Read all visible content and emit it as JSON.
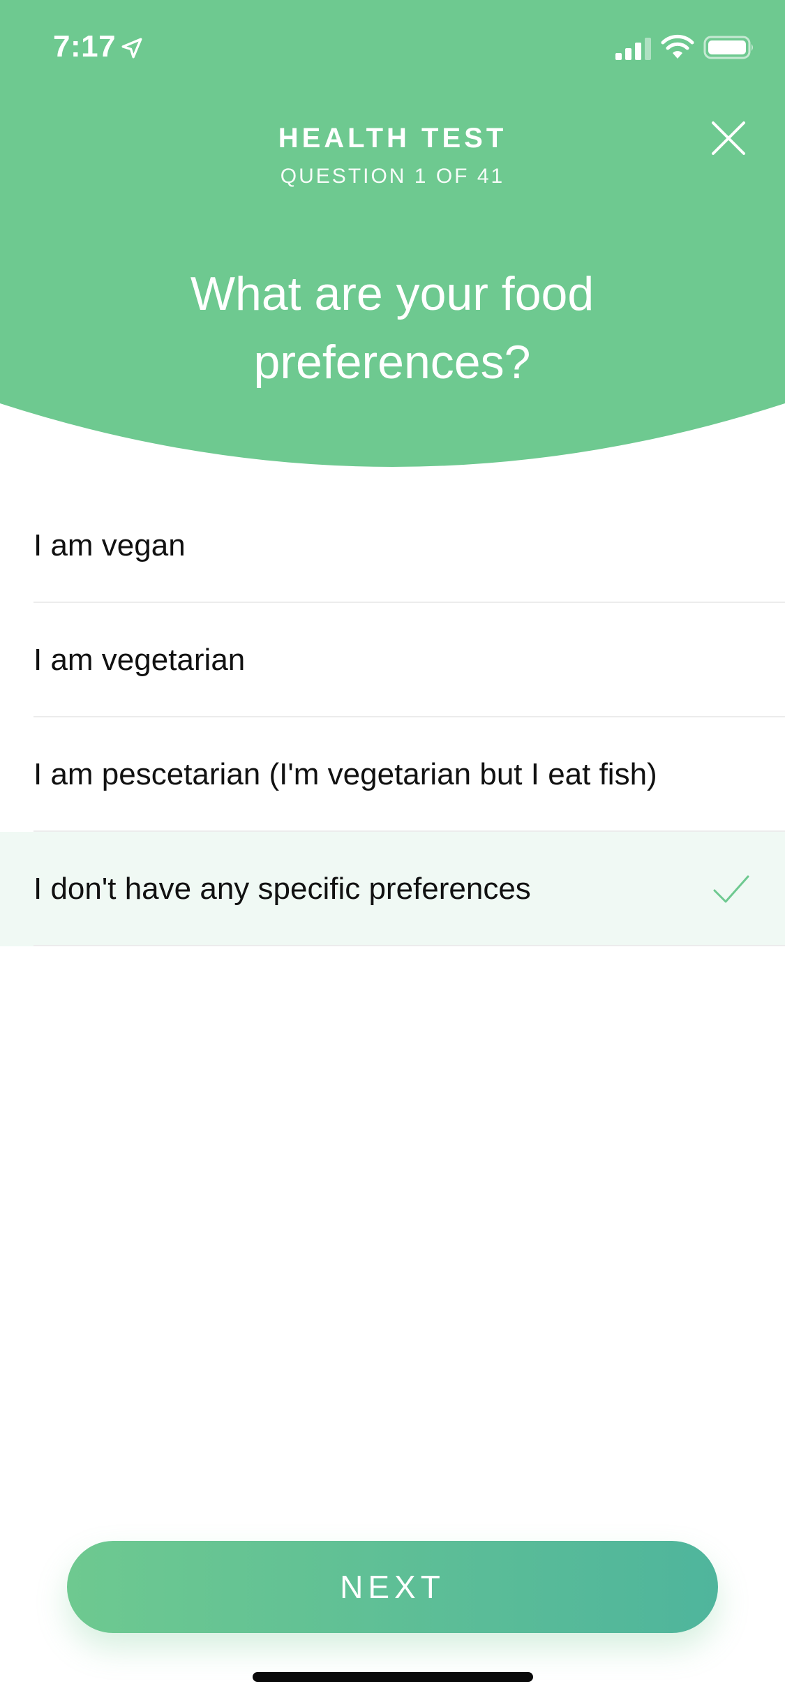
{
  "status_bar": {
    "time": "7:17",
    "icons": [
      "location-arrow-icon",
      "cellular-signal-icon",
      "wifi-icon",
      "battery-icon"
    ]
  },
  "header": {
    "title": "HEALTH TEST",
    "subtitle": "QUESTION 1 OF 41",
    "close_icon": "close-icon"
  },
  "question": {
    "text": "What are your food preferences?"
  },
  "options": [
    {
      "label": "I am vegan",
      "selected": false
    },
    {
      "label": "I am vegetarian",
      "selected": false
    },
    {
      "label": "I am pescetarian (I'm vegetarian but I eat fish)",
      "selected": false
    },
    {
      "label": "I don't have any specific preferences",
      "selected": true
    }
  ],
  "footer": {
    "next_label": "NEXT"
  },
  "colors": {
    "primary_green": "#6ec990",
    "gradient_end": "#4fb59c",
    "selected_row_bg": "#f0f9f4",
    "check_color": "#6ec990"
  }
}
